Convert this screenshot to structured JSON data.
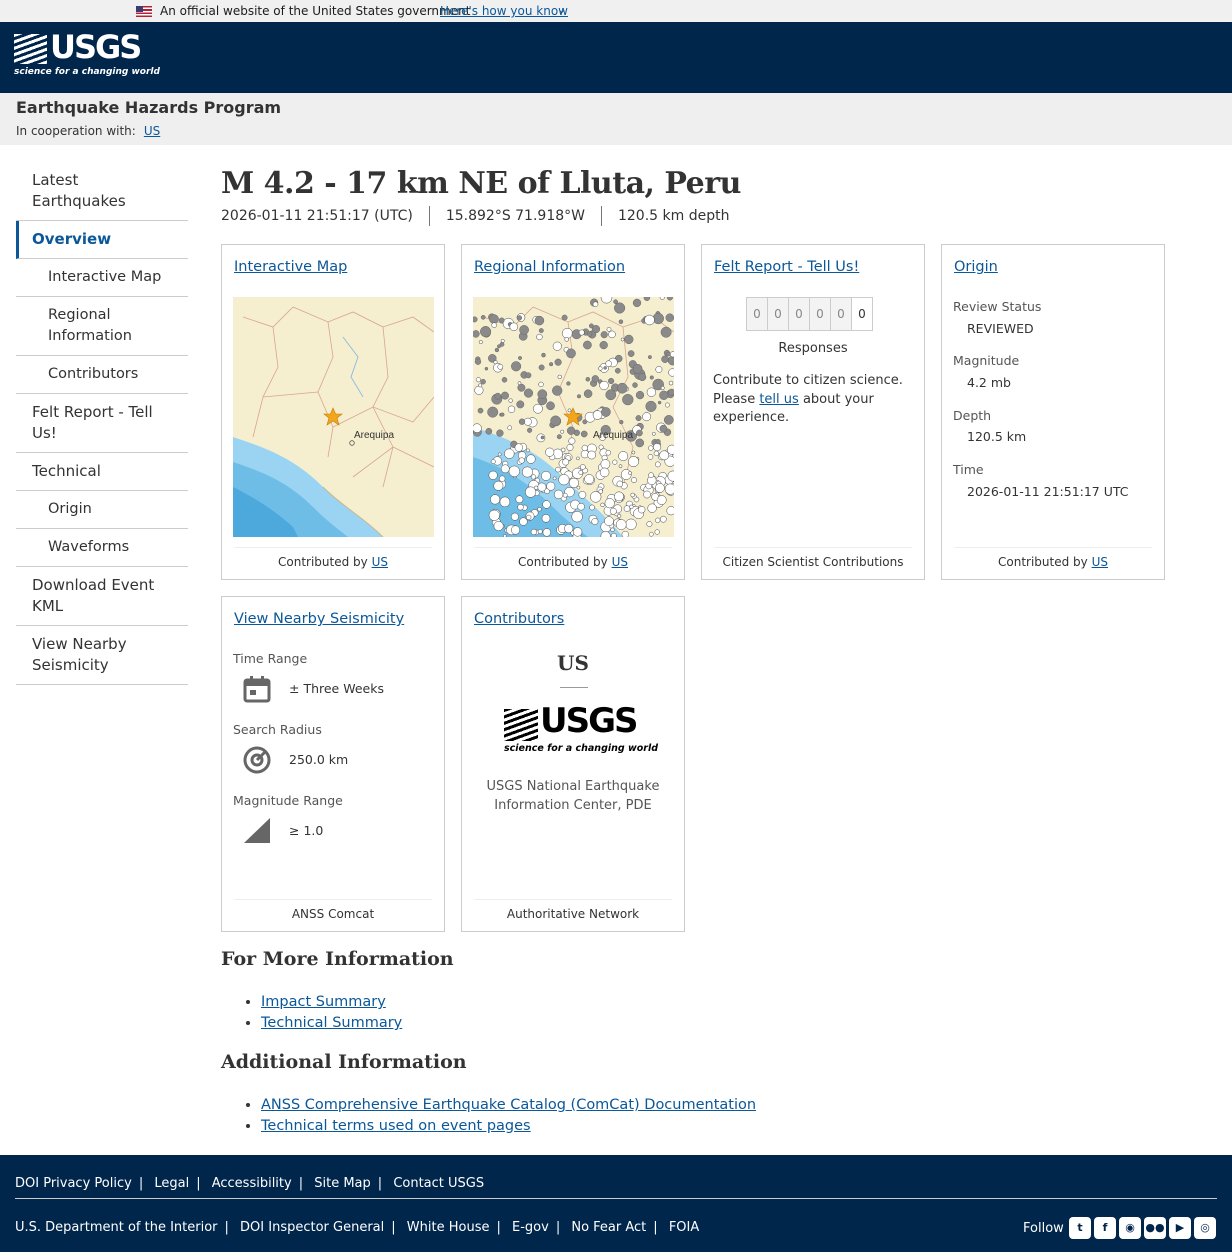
{
  "gov_banner": {
    "text": "An official website of the United States government",
    "link": "Here's how you know"
  },
  "header": {
    "logo_word": "USGS",
    "logo_tagline": "science for a changing world"
  },
  "program": {
    "title": "Earthquake Hazards Program",
    "coop_label": "In cooperation with:",
    "coop_link": "US"
  },
  "sidebar": {
    "items": [
      {
        "label": "Latest Earthquakes"
      },
      {
        "label": "Overview"
      },
      {
        "label": "Interactive Map"
      },
      {
        "label": "Regional Information"
      },
      {
        "label": "Contributors"
      },
      {
        "label": "Felt Report - Tell Us!"
      },
      {
        "label": "Technical"
      },
      {
        "label": "Origin"
      },
      {
        "label": "Waveforms"
      },
      {
        "label": "Download Event KML"
      },
      {
        "label": "View Nearby Seismicity"
      }
    ]
  },
  "event": {
    "title": "M 4.2 - 17 km NE of Lluta, Peru",
    "time": "2026-01-11 21:51:17 (UTC)",
    "location": "15.892°S 71.918°W",
    "depth": "120.5 km depth"
  },
  "cards": {
    "interactive_map": {
      "link": "Interactive Map",
      "contributed_label": "Contributed by",
      "contributed_link": "US",
      "city_label": "Arequipa"
    },
    "regional": {
      "link": "Regional Information",
      "contributed_label": "Contributed by",
      "contributed_link": "US",
      "city_label": "Arequipa"
    },
    "felt": {
      "link": "Felt Report - Tell Us!",
      "digits": [
        "0",
        "0",
        "0",
        "0",
        "0",
        "0"
      ],
      "responses": "Responses",
      "text_before": "Contribute to citizen science. Please",
      "text_link": "tell us",
      "text_after": "about your experience.",
      "footer": "Citizen Scientist Contributions"
    },
    "origin": {
      "link": "Origin",
      "review_label": "Review Status",
      "review_value": "REVIEWED",
      "magnitude_label": "Magnitude",
      "magnitude_value": "4.2 mb",
      "depth_label": "Depth",
      "depth_value": "120.5 km",
      "time_label": "Time",
      "time_value": "2026-01-11 21:51:17 UTC",
      "contributed_label": "Contributed by",
      "contributed_link": "US"
    },
    "nearby": {
      "link": "View Nearby Seismicity",
      "time_label": "Time Range",
      "time_value": "± Three Weeks",
      "radius_label": "Search Radius",
      "radius_value": "250.0 km",
      "mag_label": "Magnitude Range",
      "mag_value": "≥ 1.0",
      "footer": "ANSS Comcat"
    },
    "contributors": {
      "link": "Contributors",
      "code": "US",
      "logo_word": "USGS",
      "logo_tagline": "science for a changing world",
      "name": "USGS National Earthquake Information Center, PDE",
      "footer": "Authoritative Network"
    }
  },
  "more_info": {
    "heading": "For More Information",
    "links": [
      "Impact Summary",
      "Technical Summary"
    ]
  },
  "additional_info": {
    "heading": "Additional Information",
    "links": [
      "ANSS Comprehensive Earthquake Catalog (ComCat) Documentation",
      "Technical terms used on event pages"
    ]
  },
  "footer": {
    "row1": [
      "DOI Privacy Policy",
      "Legal",
      "Accessibility",
      "Site Map",
      "Contact USGS"
    ],
    "row2": [
      "U.S. Department of the Interior",
      "DOI Inspector General",
      "White House",
      "E-gov",
      "No Fear Act",
      "FOIA"
    ],
    "follow": "Follow",
    "social_icons": [
      "twitter-icon",
      "facebook-icon",
      "github-icon",
      "flickr-icon",
      "youtube-icon",
      "instagram-icon"
    ]
  },
  "colors": {
    "header_bg": "#00264c",
    "link": "#0a5799",
    "program_bg": "#efefef"
  }
}
